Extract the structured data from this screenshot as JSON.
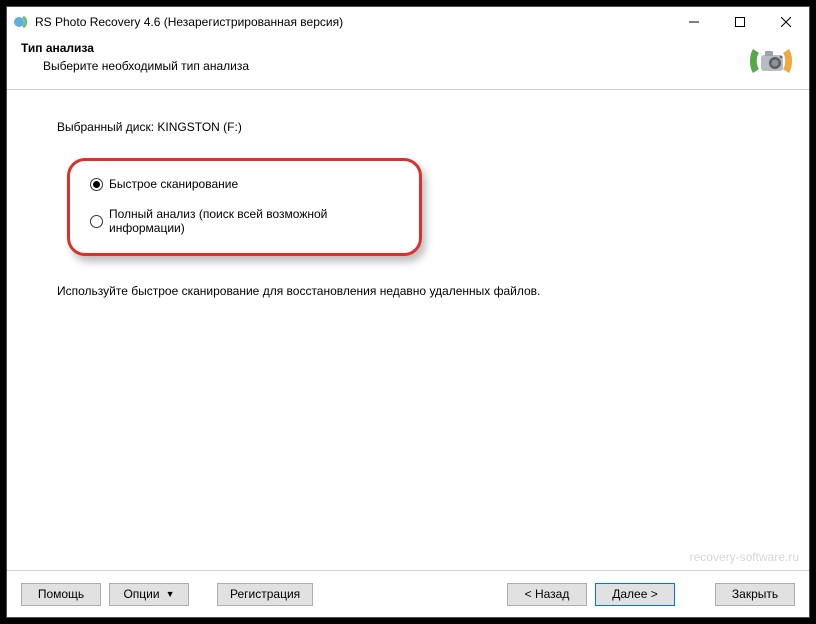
{
  "window": {
    "title": "RS Photo Recovery 4.6 (Незарегистрированная версия)"
  },
  "header": {
    "title": "Тип анализа",
    "subtitle": "Выберите необходимый тип анализа"
  },
  "content": {
    "disk_label": "Выбранный диск: KINGSTON (F:)",
    "options": {
      "fast": "Быстрое сканирование",
      "full": "Полный анализ (поиск всей возможной информации)"
    },
    "hint": "Используйте быстрое сканирование для восстановления недавно удаленных файлов.",
    "watermark": "recovery-software.ru"
  },
  "footer": {
    "help": "Помощь",
    "options": "Опции",
    "register": "Регистрация",
    "back": "< Назад",
    "next": "Далее >",
    "close": "Закрыть"
  }
}
